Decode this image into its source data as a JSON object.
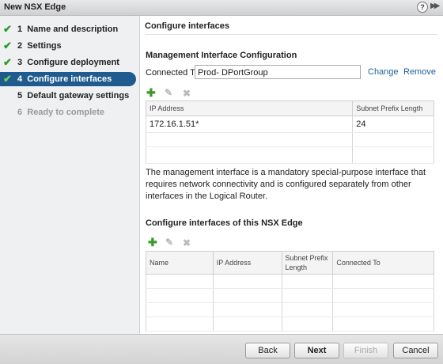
{
  "window": {
    "title": "New NSX Edge",
    "help_glyph": "?",
    "expand_glyph": "▶▶"
  },
  "steps": [
    {
      "num": "1",
      "label": "Name and description",
      "status": "done"
    },
    {
      "num": "2",
      "label": "Settings",
      "status": "done"
    },
    {
      "num": "3",
      "label": "Configure deployment",
      "status": "done"
    },
    {
      "num": "4",
      "label": "Configure interfaces",
      "status": "active"
    },
    {
      "num": "5",
      "label": "Default gateway settings",
      "status": "pending"
    },
    {
      "num": "6",
      "label": "Ready to complete",
      "status": "disabled"
    }
  ],
  "check_glyph": "✔",
  "page": {
    "title": "Configure interfaces"
  },
  "mgmt": {
    "heading": "Management Interface Configuration",
    "connected_label": "Connected To:",
    "required_mark": "*",
    "connected_value": "Prod- DPortGroup",
    "change_link": "Change",
    "remove_link": "Remove",
    "table": {
      "headers": [
        "IP Address",
        "Subnet Prefix Length"
      ],
      "rows": [
        [
          "172.16.1.51*",
          "24"
        ],
        [
          "",
          ""
        ],
        [
          "",
          ""
        ]
      ]
    },
    "description": "The management interface is a mandatory special-purpose interface that requires network connectivity and is configured separately from other interfaces in the Logical Router."
  },
  "edge_if": {
    "heading": "Configure interfaces of this NSX Edge",
    "table": {
      "headers": [
        "Name",
        "IP Address",
        "Subnet Prefix Length",
        "Connected To"
      ],
      "rows": [
        [
          "",
          "",
          "",
          ""
        ],
        [
          "",
          "",
          "",
          ""
        ],
        [
          "",
          "",
          "",
          ""
        ],
        [
          "",
          "",
          "",
          ""
        ]
      ]
    }
  },
  "toolbar": {
    "add_glyph": "✚",
    "edit_glyph": "✎",
    "delete_glyph": "✖"
  },
  "buttons": {
    "back": "Back",
    "next": "Next",
    "finish": "Finish",
    "cancel": "Cancel"
  }
}
